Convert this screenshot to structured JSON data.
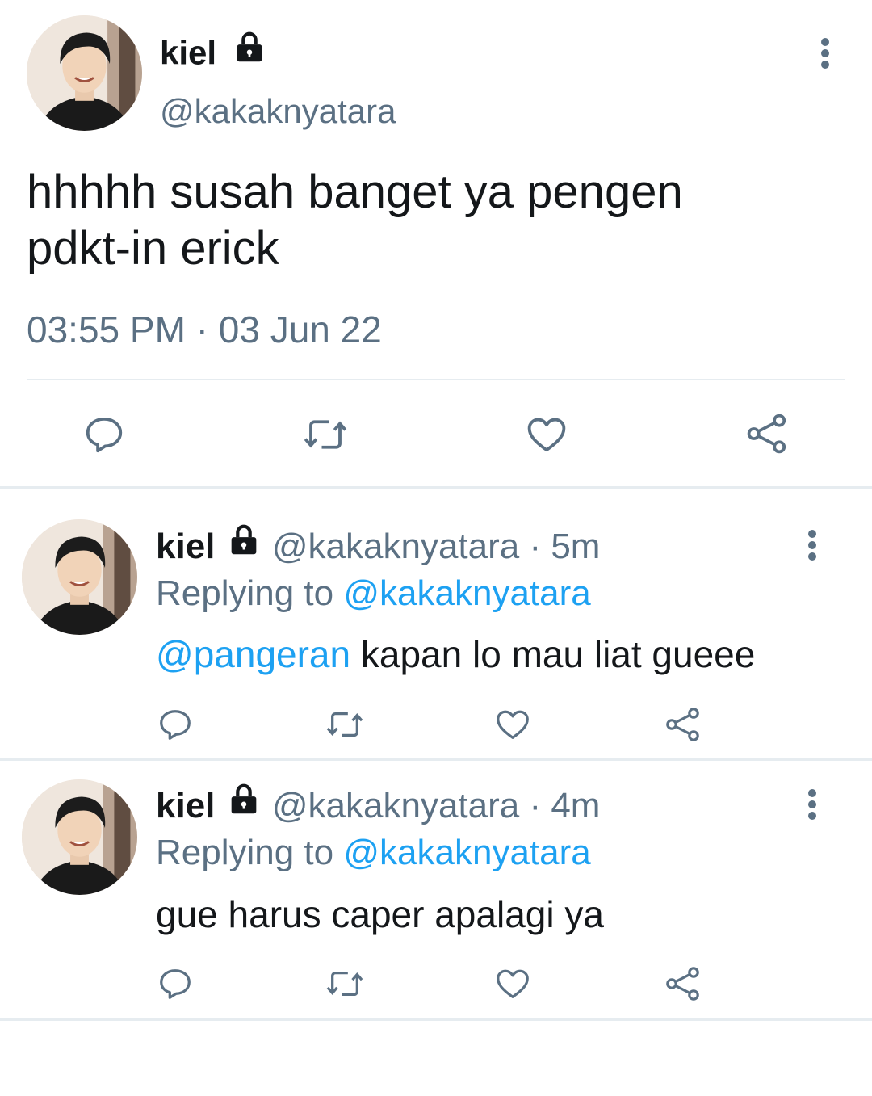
{
  "main_tweet": {
    "display_name": "kiel",
    "handle": "@kakaknyatara",
    "text_line1": "hhhhh susah banget ya pengen",
    "text_line2": "pdkt-in erick",
    "timestamp": "03:55 PM · 03 Jun 22"
  },
  "replies": [
    {
      "display_name": "kiel",
      "handle_time": "@kakaknyatara · 5m",
      "replying_prefix": "Replying to ",
      "replying_handle": "@kakaknyatara",
      "mention": "@pangeran",
      "text": " kapan lo mau liat gueee"
    },
    {
      "display_name": "kiel",
      "handle_time": "@kakaknyatara · 4m",
      "replying_prefix": "Replying to ",
      "replying_handle": "@kakaknyatara",
      "text": "gue harus caper apalagi ya"
    }
  ],
  "icons": {
    "lock": "lock-icon",
    "more": "more-vertical-icon",
    "reply": "reply-icon",
    "retweet": "retweet-icon",
    "like": "heart-icon",
    "share": "share-icon"
  },
  "colors": {
    "text": "#14171a",
    "secondary": "#5b7083",
    "link": "#1da1f2",
    "divider": "#e6ecf0"
  }
}
